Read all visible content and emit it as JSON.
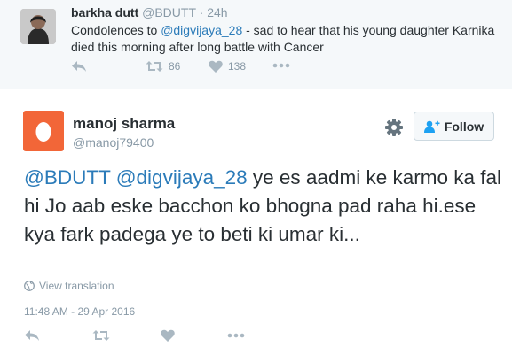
{
  "parent_tweet": {
    "name": "barkha dutt",
    "handle": "@BDUTT",
    "time": "24h",
    "text_prefix": "Condolences to ",
    "mention": "@digvijaya_28",
    "text_suffix": " - sad to hear that his young daughter Karnika died this morning after long battle with Cancer",
    "retweets": "86",
    "likes": "138",
    "icons": [
      "reply-icon",
      "retweet-icon",
      "heart-icon",
      "more-icon"
    ]
  },
  "main_tweet": {
    "name": "manoj sharma",
    "handle": "@manoj79400",
    "follow_label": "Follow",
    "mention_1": "@BDUTT",
    "mention_2": "@digvijaya_28",
    "text": " ye es aadmi ke karmo ka fal hi Jo aab eske bacchon ko bhogna pad raha hi.ese kya fark padega ye to beti ki umar ki...",
    "translate_label": "View translation",
    "timestamp": "11:48 AM - 29 Apr 2016",
    "icons": [
      "reply-icon",
      "retweet-icon",
      "heart-icon",
      "more-icon",
      "gear-icon",
      "add-user-icon",
      "globe-icon"
    ]
  },
  "colors": {
    "link": "#2b7bb9",
    "muted": "#8899a6",
    "text": "#292f33",
    "avatar_orange": "#f26638"
  }
}
